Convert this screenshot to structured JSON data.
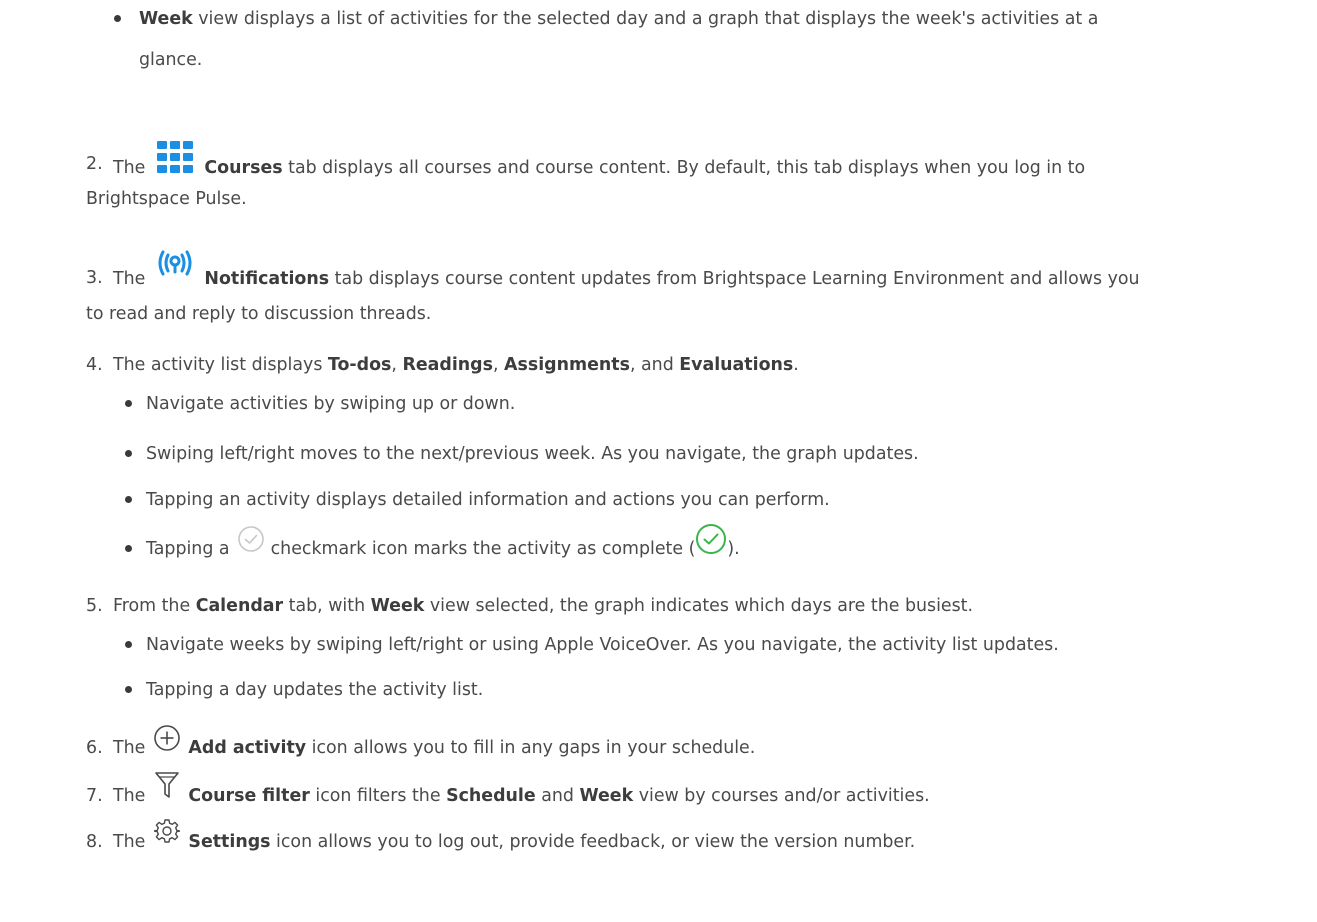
{
  "colors": {
    "text": "#4a4a4a",
    "bold_text": "#3d3d3d",
    "accent_blue": "#1a8fe3",
    "check_gray": "#c7c7c7",
    "check_green": "#3ab54a",
    "outline_icon": "#4a4a4a"
  },
  "week_bullet": {
    "bold": "Week",
    "line1": " view displays a list of activities for the selected day and a graph that displays the week's activities at a",
    "line2": "glance."
  },
  "items": [
    {
      "number": "2.",
      "pre": "The",
      "icon": "grid-icon",
      "bold": "Courses",
      "line1": " tab displays all courses and course content. By default, this tab displays when you log in to",
      "line2": "Brightspace Pulse."
    },
    {
      "number": "3.",
      "pre": "The",
      "icon": "broadcast-icon",
      "bold": "Notifications",
      "line1": " tab displays course content updates from Brightspace Learning Environment and allows you",
      "line2": "to read and reply to discussion threads."
    },
    {
      "number": "4.",
      "t1": "The activity list displays ",
      "b1": "To-dos",
      "t2": ", ",
      "b2": "Readings",
      "t3": ", ",
      "b3": "Assignments",
      "t4": ", and ",
      "b4": "Evaluations",
      "t5": ".",
      "bullets": [
        "Navigate activities by swiping up or down.",
        "Swiping left/right moves to the next/previous week. As you navigate, the graph updates.",
        "Tapping an activity displays detailed information and actions you can perform."
      ],
      "check_bullet": {
        "pre": "Tapping a",
        "icon_gray": "checkmark-circle-gray-icon",
        "mid": " checkmark icon marks the activity as complete (",
        "icon_green": "checkmark-circle-green-icon",
        "post": ")."
      }
    },
    {
      "number": "5.",
      "t1": "From the ",
      "b1": "Calendar",
      "t2": " tab, with ",
      "b2": "Week",
      "t3": " view selected, the graph indicates which days are the busiest.",
      "bullets": [
        "Navigate weeks by swiping left/right or using Apple VoiceOver. As you navigate, the activity list updates.",
        "Tapping a day updates the activity list."
      ]
    },
    {
      "number": "6.",
      "pre": "The",
      "icon": "plus-circle-icon",
      "bold": "Add activity",
      "rest": " icon allows you to fill in any gaps in your schedule."
    },
    {
      "number": "7.",
      "pre": "The",
      "icon": "filter-icon",
      "bold": "Course filter",
      "mid": " icon filters the ",
      "b2": "Schedule",
      "t3": " and ",
      "b3": "Week",
      "t4": " view by courses and/or activities."
    },
    {
      "number": "8.",
      "pre": "The",
      "icon": "gear-icon",
      "bold": "Settings",
      "rest": " icon allows you to log out, provide feedback, or view the version number."
    }
  ]
}
